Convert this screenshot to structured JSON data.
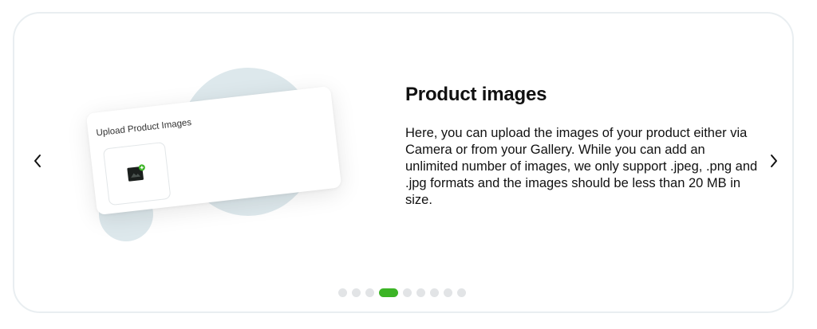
{
  "slide": {
    "title": "Product images",
    "description": "Here, you can upload the images of your product either via Camera or from your Gallery. While you can add an unlimited number of images, we only support .jpeg, .png and .jpg formats and the images should be less than 20 MB in size."
  },
  "illustration": {
    "upload_title": "Upload Product Images",
    "upload_icon": "image-add-icon"
  },
  "navigation": {
    "prev_icon": "chevron-left-icon",
    "next_icon": "chevron-right-icon"
  },
  "pagination": {
    "total": 9,
    "active_index": 3
  },
  "colors": {
    "accent": "#3cb426",
    "dot_inactive": "#e2e4e6",
    "blob": "#dde8ec",
    "card_border": "#e9eef1"
  }
}
